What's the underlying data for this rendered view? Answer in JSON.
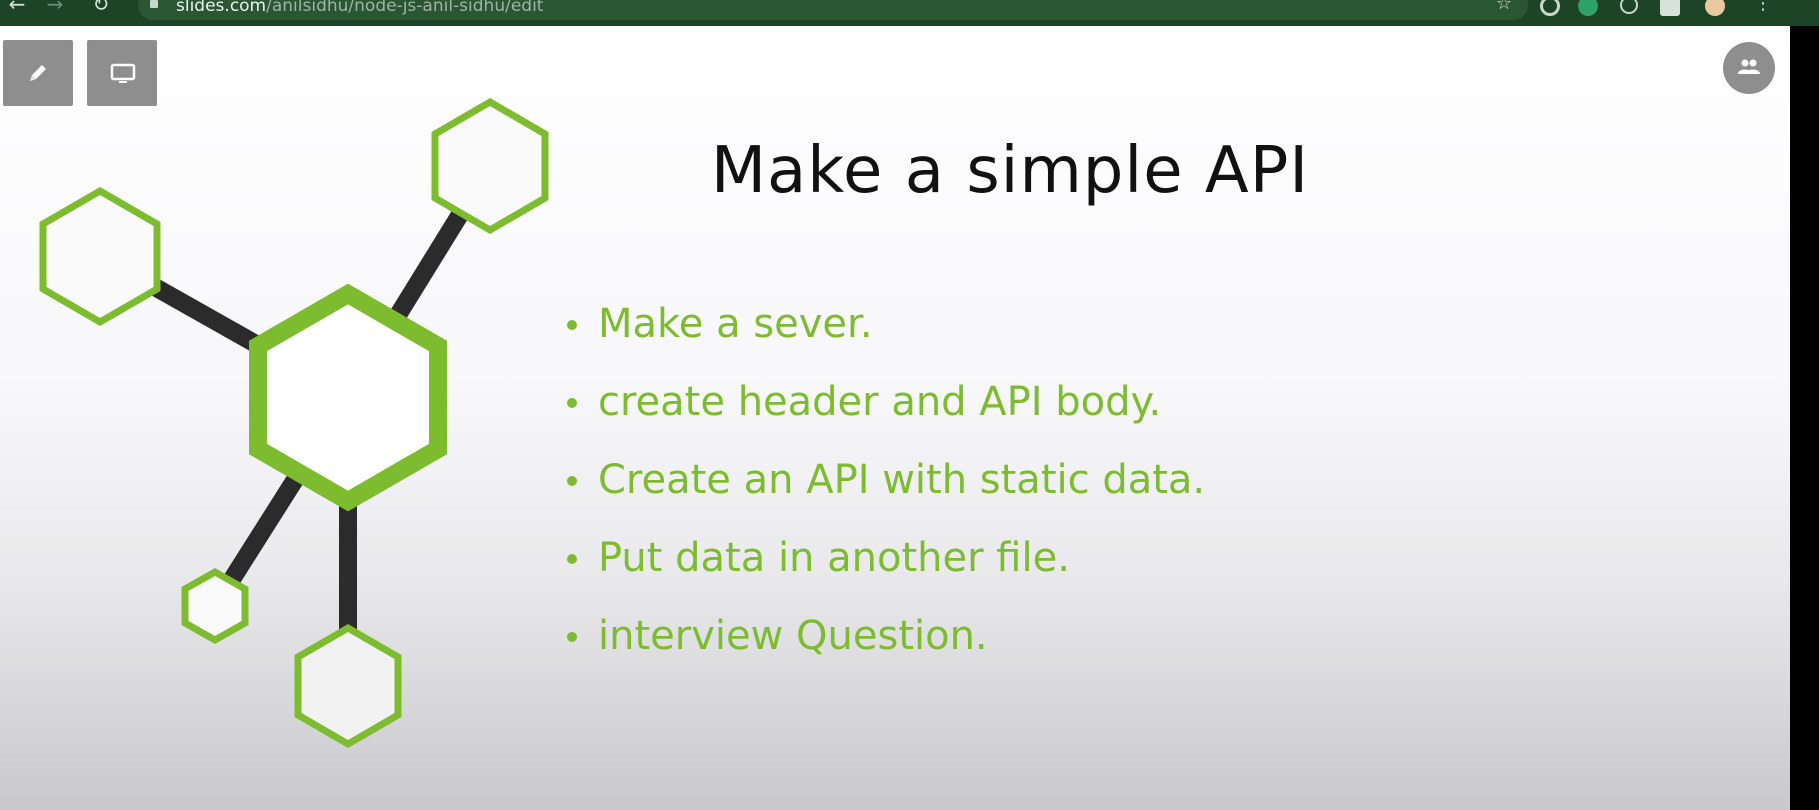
{
  "browser": {
    "url_host": "slides.com",
    "url_path": "/anilsidhu/node-js-anil-sidhu/edit"
  },
  "icons": {
    "back": "arrow-left-icon",
    "forward": "arrow-right-icon",
    "reload": "reload-icon",
    "bookmark": "star-icon",
    "edit": "pencil-icon",
    "present": "monitor-icon",
    "collaborators": "people-icon"
  },
  "slide": {
    "title": "Make a simple API",
    "bullets": [
      "Make a sever.",
      "create header and API body.",
      "Create an API with static data.",
      "Put data in another file.",
      "interview Question."
    ]
  },
  "colors": {
    "accent": "#7dbb2f",
    "title": "#111111",
    "chrome": "#1d4426",
    "connector": "#2b2b2b",
    "button": "#8e8e8e"
  }
}
